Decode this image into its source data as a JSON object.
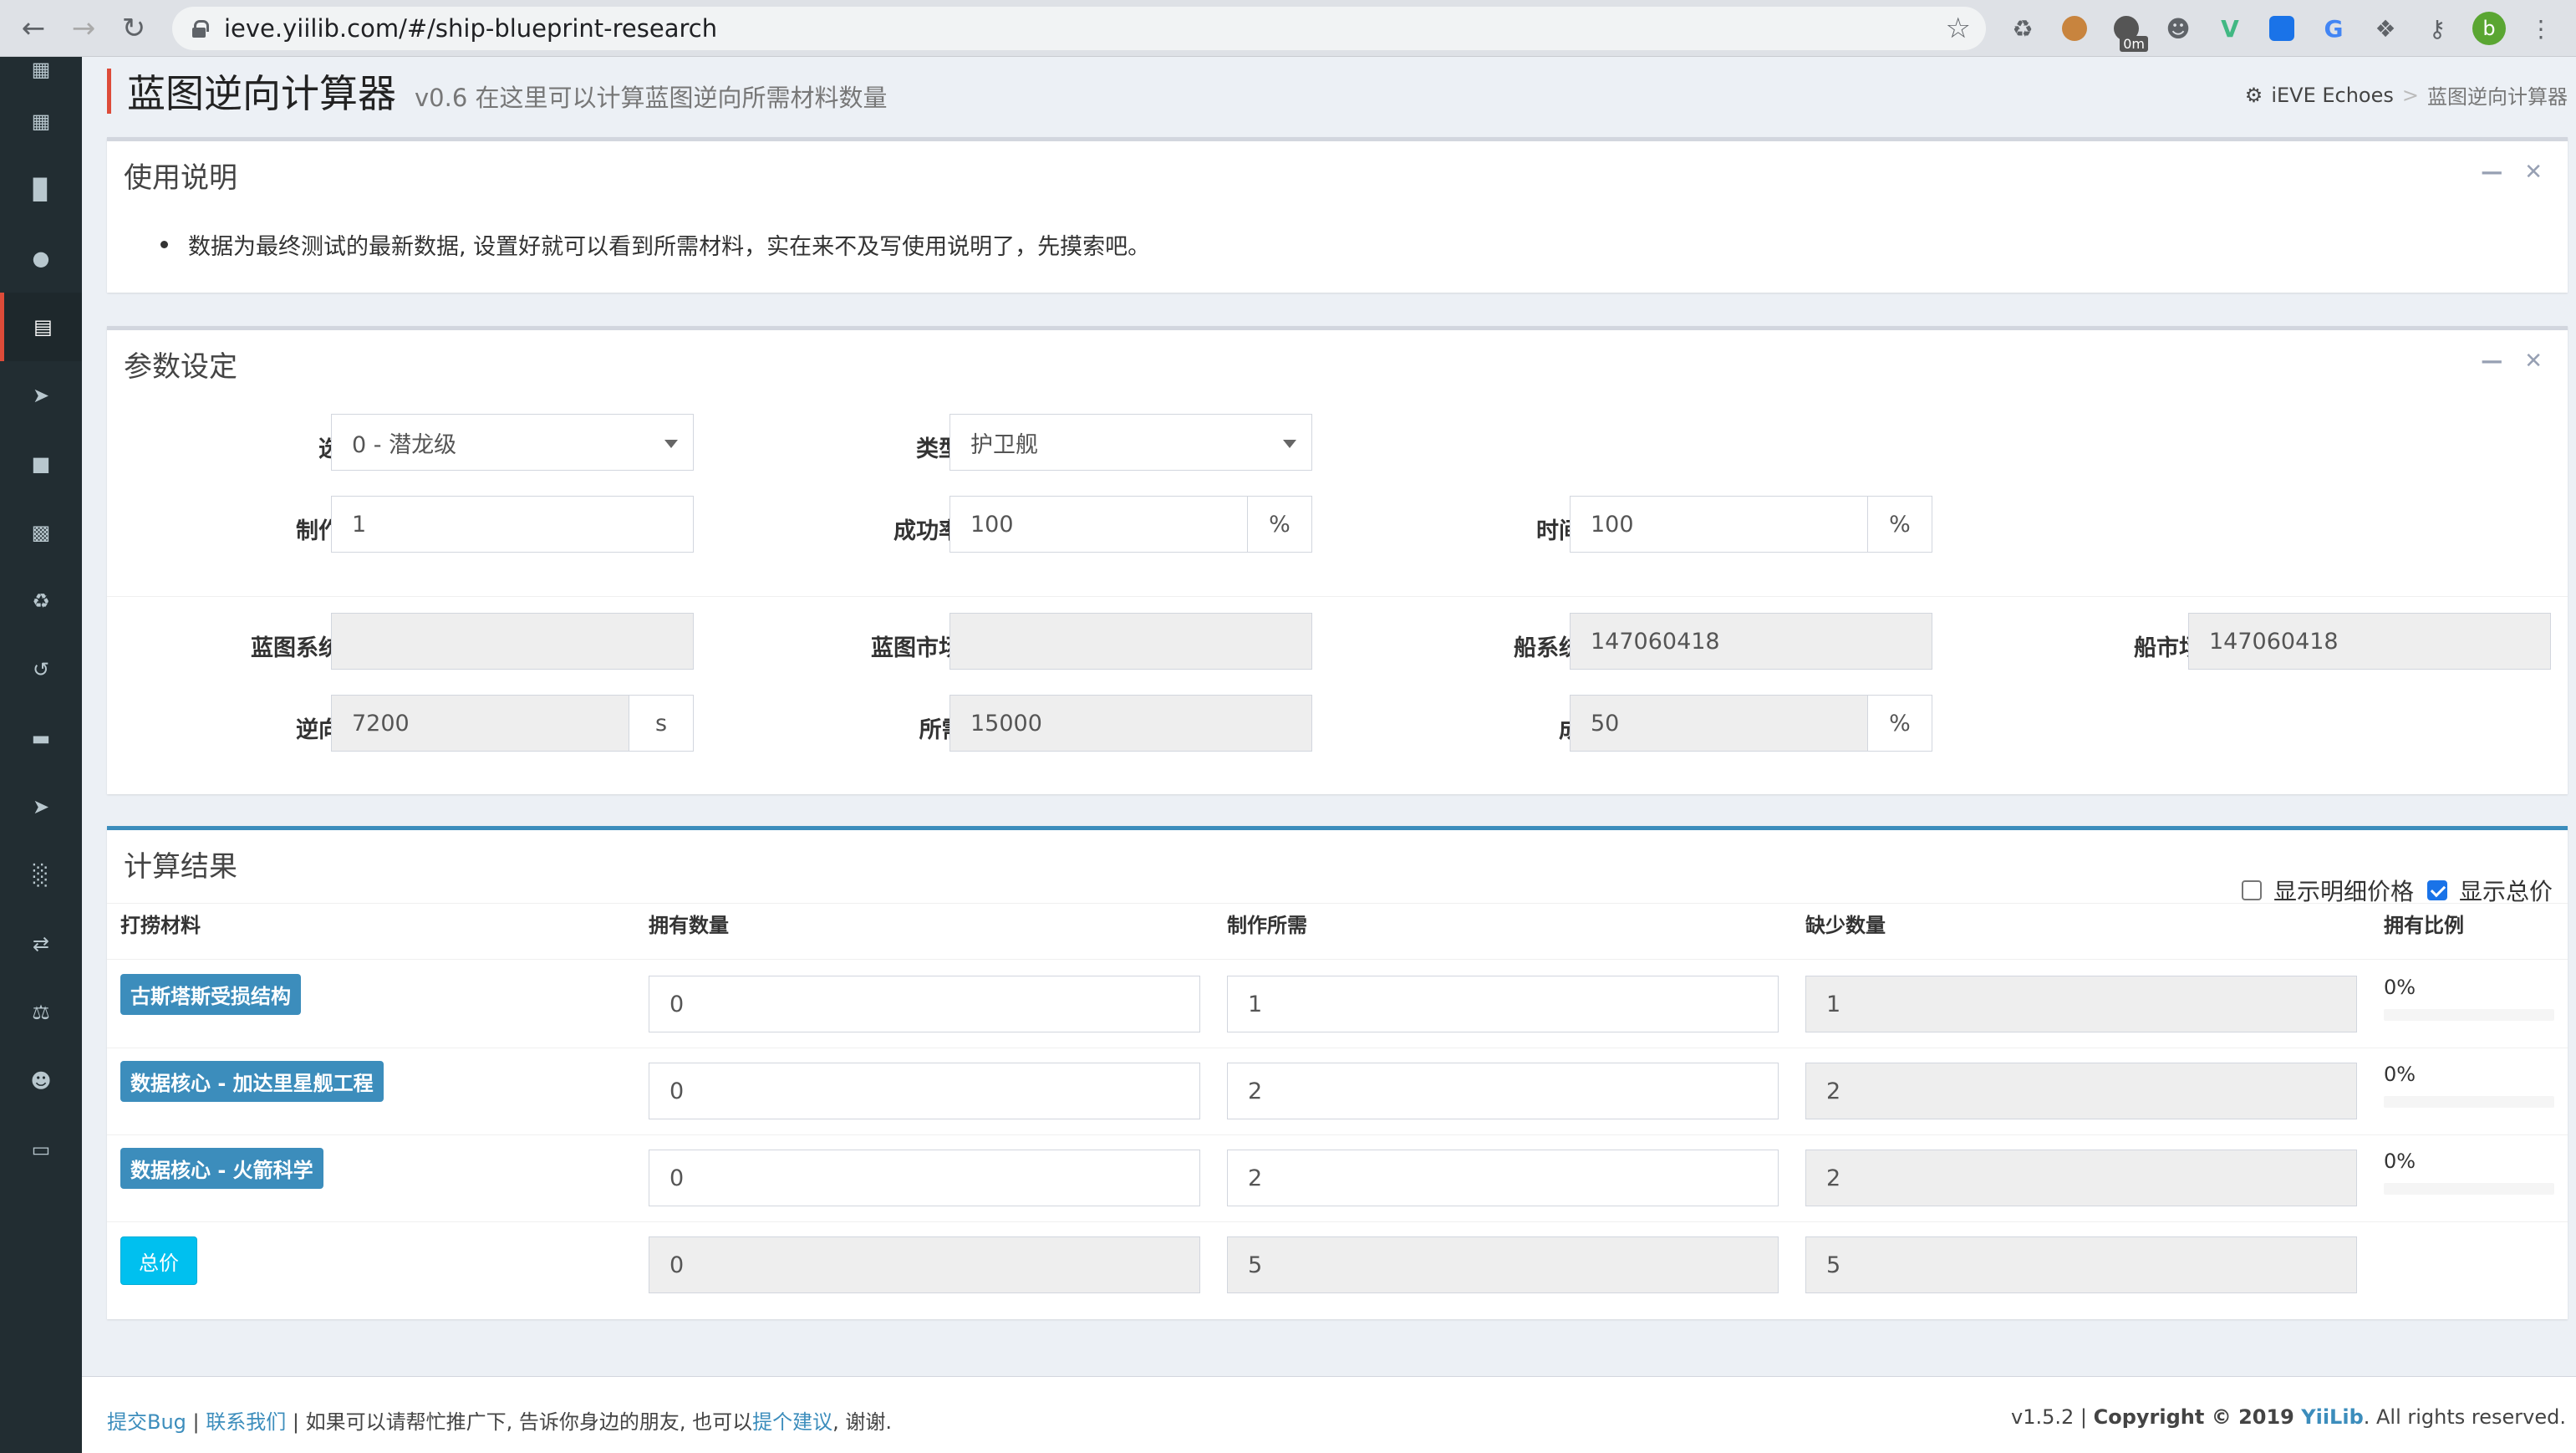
{
  "browser": {
    "url": "ieve.yiilib.com/#/ship-blueprint-research",
    "ext_badge": "0m",
    "avatar_letter": "b"
  },
  "sidebar": {
    "icons": [
      "table-icon",
      "table-icon",
      "signal-icon",
      "globe-icon",
      "file-icon",
      "send-icon",
      "cube-icon",
      "cubes-icon",
      "recycle-icon",
      "retweet-icon",
      "battery-icon",
      "plane-icon",
      "bar-chart-icon",
      "exchange-icon",
      "balance-scale-icon",
      "users-icon",
      "desktop-icon"
    ],
    "active_index": 4
  },
  "header": {
    "title": "蓝图逆向计算器",
    "subtitle": "v0.6 在这里可以计算蓝图逆向所需材料数量",
    "breadcrumb": {
      "root": "iEVE Echoes",
      "current": "蓝图逆向计算器"
    }
  },
  "usage": {
    "title": "使用说明",
    "text": "数据为最终测试的最新数据, 设置好就可以看到所需材料，实在来不及写使用说明了，先摸索吧。"
  },
  "params": {
    "title": "参数设定",
    "ship_label": "选择船",
    "ship_value": "0 - 潜龙级",
    "type_label": "类型筛选",
    "type_value": "护卫舰",
    "qty_label": "制作数量",
    "qty_value": "1",
    "rate_mult_label": "成功率倍数",
    "rate_mult_value": "100",
    "time_eff_label": "时间效率",
    "time_eff_value": "100",
    "percent": "%",
    "bp_sys_price_label": "蓝图系统售价",
    "bp_sys_price_value": "",
    "bp_market_price_label": "蓝图市场价格",
    "bp_market_price_value": "",
    "ship_sys_price_label": "船系统售价",
    "ship_sys_price_value": "147060418",
    "ship_market_price_label": "船市场价格",
    "ship_market_price_value": "147060418",
    "time_cost_label": "逆向耗时",
    "time_cost_value": "7200",
    "time_unit": "s",
    "isk_label": "所需ISK",
    "isk_value": "15000",
    "success_label": "成功率",
    "success_value": "50"
  },
  "results": {
    "title": "计算结果",
    "show_detail_label": "显示明细价格",
    "show_detail_checked": false,
    "show_total_label": "显示总价",
    "show_total_checked": true,
    "columns": [
      "打捞材料",
      "拥有数量",
      "制作所需",
      "缺少数量",
      "拥有比例"
    ],
    "rows": [
      {
        "material": "古斯塔斯受损结构",
        "owned": "0",
        "required": "1",
        "missing": "1",
        "ratio": "0%",
        "ratio_value": 0
      },
      {
        "material": "数据核心 - 加达里星舰工程",
        "owned": "0",
        "required": "2",
        "missing": "2",
        "ratio": "0%",
        "ratio_value": 0
      },
      {
        "material": "数据核心 - 火箭科学",
        "owned": "0",
        "required": "2",
        "missing": "2",
        "ratio": "0%",
        "ratio_value": 0
      }
    ],
    "total": {
      "label": "总价",
      "owned": "0",
      "required": "5",
      "missing": "5"
    }
  },
  "footer": {
    "bug_link": "提交Bug",
    "sep1": " | ",
    "contact_link": "联系我们",
    "text1": " | 如果可以请帮忙推广下, 告诉你身边的朋友, 也可以",
    "suggest_link": "提个建议",
    "text2": ", 谢谢.",
    "version": "v1.5.2 | ",
    "copyright": "Copyright © 2019 ",
    "brand": "YiiLib",
    "rights": ". All rights reserved."
  }
}
